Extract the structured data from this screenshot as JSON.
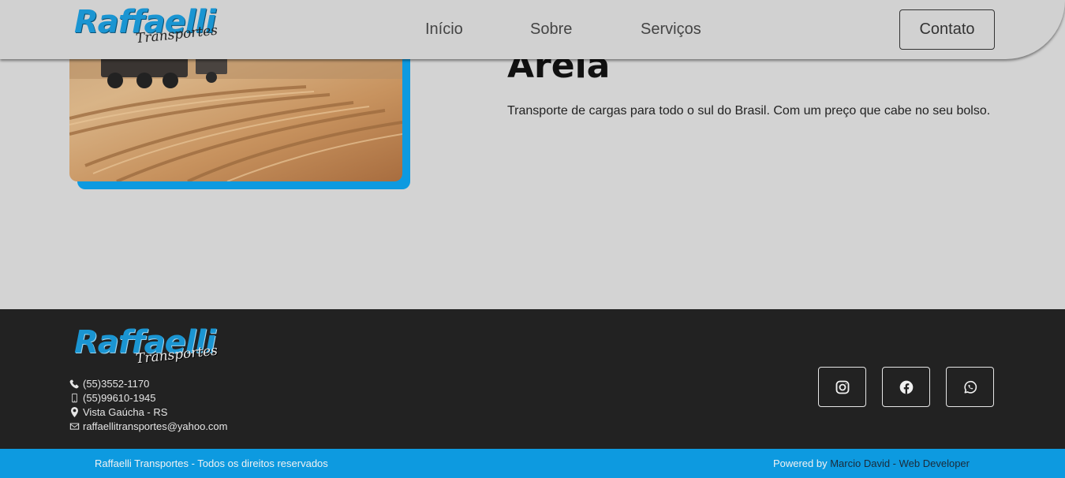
{
  "header": {
    "logo": {
      "main": "Raffaelli",
      "sub": "Transportes"
    },
    "nav": [
      {
        "label": "Início"
      },
      {
        "label": "Sobre"
      },
      {
        "label": "Serviços"
      }
    ],
    "contact_button": "Contato"
  },
  "hero": {
    "title": "Areia",
    "description": "Transporte de cargas para todo o sul do Brasil. Com um preço que cabe no seu bolso."
  },
  "footer": {
    "logo": {
      "main": "Raffaelli",
      "sub": "Transportes"
    },
    "contacts": [
      {
        "icon": "phone-icon",
        "text": "(55)3552-1170"
      },
      {
        "icon": "mobile-icon",
        "text": "(55)99610-1945"
      },
      {
        "icon": "location-pin-icon",
        "text": "Vista Gaúcha - RS"
      },
      {
        "icon": "envelope-icon",
        "text": "raffaellitransportes@yahoo.com"
      }
    ],
    "social": [
      "instagram-icon",
      "facebook-icon",
      "whatsapp-icon"
    ],
    "rights": "Raffaelli Transportes - Todos os direitos reservados",
    "powered_prefix": "Powered by ",
    "powered_by": "Marcio David - Web Developer"
  },
  "colors": {
    "accent": "#0d9ae0",
    "page_background": "#d3d3d3",
    "footer_background": "#222222"
  }
}
